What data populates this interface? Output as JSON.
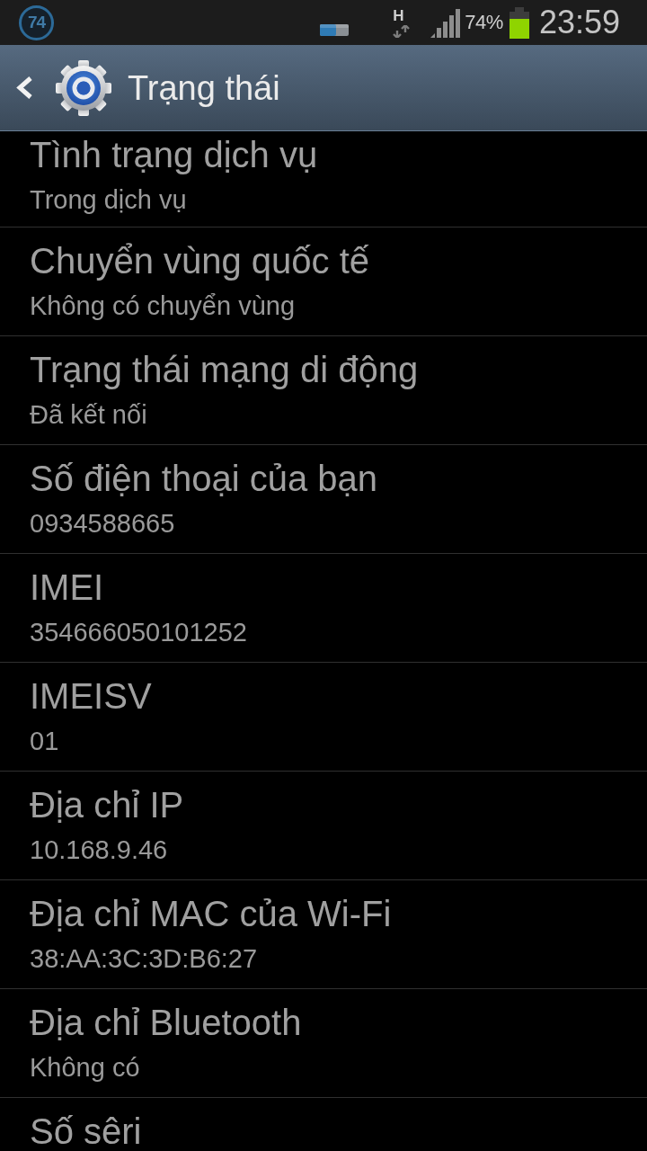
{
  "status_bar": {
    "badge": "74",
    "network_type": "H",
    "battery_text": "74%",
    "time": "23:59"
  },
  "header": {
    "title": "Trạng thái"
  },
  "items": [
    {
      "title": "Tình trạng dịch vụ",
      "value": "Trong dịch vụ"
    },
    {
      "title": "Chuyển vùng quốc tế",
      "value": "Không có chuyển vùng"
    },
    {
      "title": "Trạng thái mạng di động",
      "value": "Đã kết nối"
    },
    {
      "title": "Số điện thoại của bạn",
      "value": "0934588665"
    },
    {
      "title": "IMEI",
      "value": "354666050101252"
    },
    {
      "title": "IMEISV",
      "value": "01"
    },
    {
      "title": "Địa chỉ IP",
      "value": "10.168.9.46"
    },
    {
      "title": "Địa chỉ MAC của Wi-Fi",
      "value": "38:AA:3C:3D:B6:27"
    },
    {
      "title": "Địa chỉ Bluetooth",
      "value": "Không có"
    },
    {
      "title": "Số sêri"
    }
  ]
}
